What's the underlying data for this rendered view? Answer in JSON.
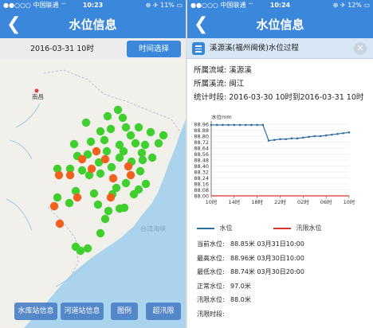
{
  "status_left": {
    "carrier": "●●○○○ 中国联通 ⌔",
    "time": "10:23",
    "battery": "⊕ ✈ 11% ▭"
  },
  "status_right": {
    "carrier": "●●○○○ 中国联通 ⌔",
    "time": "10:24",
    "battery": "⊕ ✈ 12% ▭"
  },
  "left": {
    "nav_title": "水位信息",
    "date": "2016-03-31 10时",
    "time_select": "时间选择",
    "map_labels": {
      "city": "南昌",
      "sea": "台湾海峡"
    },
    "bottom_buttons": [
      "水库站信息",
      "河道站信息",
      "图例",
      "超汛限"
    ]
  },
  "right": {
    "nav_title": "水位信息",
    "info_title": "溪源溪(福州闽侯)水位过程",
    "basin_label": "所属流域:",
    "basin_value": "溪源溪",
    "river_label": "所属溪流:",
    "river_value": "闽江",
    "period_label": "统计时段:",
    "period_value": "2016-03-30 10时到2016-03-31 10时",
    "legend_water": "水位",
    "legend_flood": "汛限水位",
    "stats": [
      {
        "k": "当前水位:",
        "v": "88.85米 03月31日10:00"
      },
      {
        "k": "最高水位:",
        "v": "88.96米 03月30日10:00"
      },
      {
        "k": "最低水位:",
        "v": "88.74米 03月30日20:00"
      },
      {
        "k": "正常水位:",
        "v": "97.0米"
      },
      {
        "k": "汛限水位:",
        "v": "88.0米"
      },
      {
        "k": "汛限时段:",
        "v": ""
      }
    ]
  },
  "colors": {
    "accent": "#3b87dc",
    "series": "#2e6f9e",
    "flood": "#d9332b",
    "station_green": "#3fcf2e",
    "station_orange": "#f0611f"
  },
  "chart_data": {
    "type": "line",
    "ylabel": "水位mm",
    "yticks": [
      "88.96",
      "88.88",
      "88.80",
      "88.72",
      "88.64",
      "88.56",
      "88.48",
      "88.40",
      "88.32",
      "88.24",
      "88.16",
      "88.08",
      "88.00"
    ],
    "xticks": [
      "10时",
      "14时",
      "18时",
      "22时",
      "02时",
      "06时",
      "10时"
    ],
    "ylim": [
      88.0,
      88.96
    ],
    "series": [
      {
        "name": "水位",
        "x": [
          0,
          1,
          2,
          3,
          4,
          5,
          6,
          7,
          8,
          9,
          10,
          11,
          12,
          13,
          14,
          15,
          16,
          17,
          18,
          19,
          20,
          21,
          22,
          23,
          24
        ],
        "values": [
          88.95,
          88.95,
          88.95,
          88.95,
          88.95,
          88.95,
          88.95,
          88.95,
          88.95,
          88.95,
          88.74,
          88.75,
          88.76,
          88.76,
          88.77,
          88.77,
          88.78,
          88.79,
          88.8,
          88.8,
          88.81,
          88.82,
          88.83,
          88.84,
          88.85
        ]
      },
      {
        "name": "汛限水位",
        "x": [
          0,
          24
        ],
        "values": [
          88.0,
          88.0
        ]
      }
    ]
  },
  "stations": {
    "green": [
      [
        148,
        138
      ],
      [
        135,
        146
      ],
      [
        154,
        148
      ],
      [
        108,
        154
      ],
      [
        158,
        160
      ],
      [
        139,
        162
      ],
      [
        126,
        165
      ],
      [
        164,
        170
      ],
      [
        174,
        160
      ],
      [
        189,
        166
      ],
      [
        205,
        170
      ],
      [
        93,
        181
      ],
      [
        114,
        178
      ],
      [
        131,
        176
      ],
      [
        150,
        182
      ],
      [
        170,
        180
      ],
      [
        182,
        182
      ],
      [
        199,
        180
      ],
      [
        134,
        190
      ],
      [
        155,
        190
      ],
      [
        178,
        192
      ],
      [
        110,
        194
      ],
      [
        97,
        196
      ],
      [
        124,
        204
      ],
      [
        150,
        198
      ],
      [
        165,
        203
      ],
      [
        179,
        201
      ],
      [
        191,
        198
      ],
      [
        72,
        212
      ],
      [
        88,
        212
      ],
      [
        103,
        214
      ],
      [
        140,
        210
      ],
      [
        176,
        215
      ],
      [
        112,
        220
      ],
      [
        126,
        218
      ],
      [
        158,
        230
      ],
      [
        183,
        231
      ],
      [
        146,
        236
      ],
      [
        95,
        240
      ],
      [
        118,
        243
      ],
      [
        141,
        244
      ],
      [
        168,
        244
      ],
      [
        174,
        238
      ],
      [
        72,
        248
      ],
      [
        87,
        255
      ],
      [
        123,
        257
      ],
      [
        150,
        262
      ],
      [
        136,
        265
      ],
      [
        156,
        261
      ],
      [
        132,
        275
      ],
      [
        126,
        293
      ],
      [
        95,
        310
      ],
      [
        101,
        315
      ],
      [
        110,
        312
      ]
    ],
    "orange": [
      [
        121,
        190
      ],
      [
        103,
        200
      ],
      [
        132,
        200
      ],
      [
        88,
        220
      ],
      [
        115,
        212
      ],
      [
        161,
        209
      ],
      [
        74,
        220
      ],
      [
        164,
        220
      ],
      [
        142,
        224
      ],
      [
        97,
        248
      ],
      [
        68,
        259
      ],
      [
        139,
        248
      ],
      [
        75,
        281
      ]
    ]
  }
}
